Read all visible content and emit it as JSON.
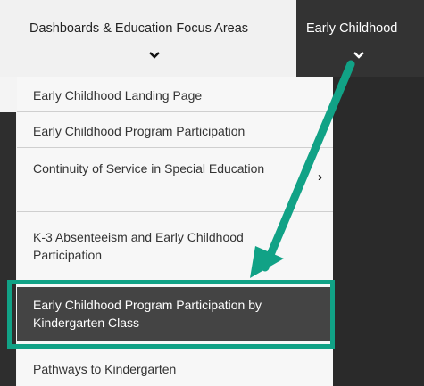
{
  "nav": {
    "tabs": [
      {
        "label": "Dashboards & Education Focus Areas"
      },
      {
        "label": "Early Childhood"
      }
    ],
    "chevron": "⌄"
  },
  "menu": {
    "items": [
      {
        "label": "Early Childhood Landing Page"
      },
      {
        "label": "Early Childhood Program Participation"
      },
      {
        "label": "Continuity of Service in Special Education",
        "has_submenu": true
      },
      {
        "label": "K-3 Absenteeism and Early Childhood Participation"
      },
      {
        "label": "Early Childhood Program Participation by Kindergarten Class",
        "active": true
      },
      {
        "label": "Pathways to Kindergarten"
      }
    ],
    "submenu_arrow": "›"
  },
  "annotation": {
    "color": "#11a286"
  }
}
